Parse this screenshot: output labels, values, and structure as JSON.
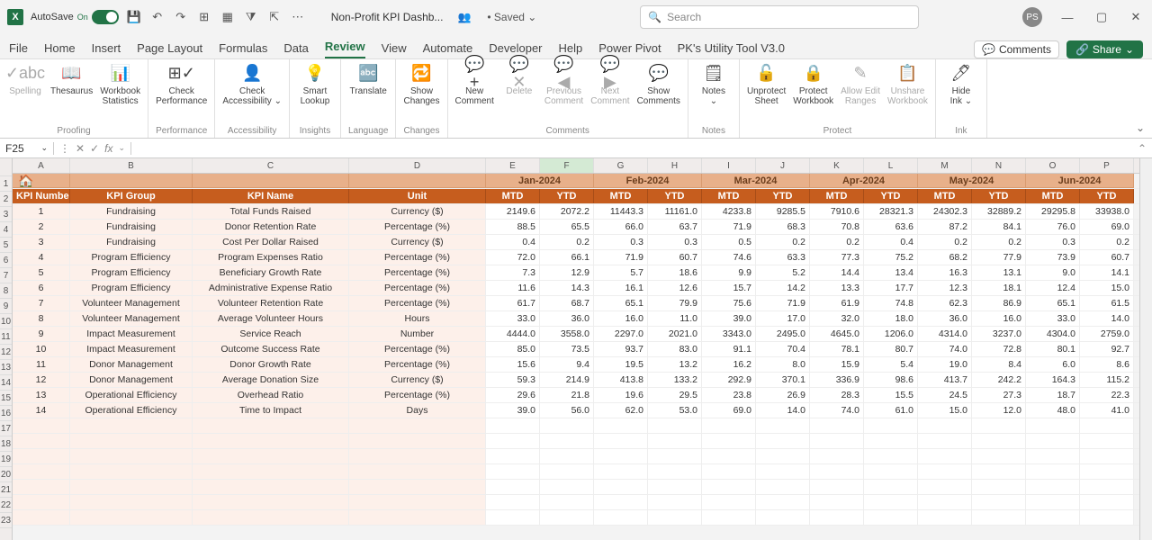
{
  "titlebar": {
    "autosave_label": "AutoSave",
    "autosave_state": "On",
    "filename": "Non-Profit KPI Dashb...",
    "saved_status": "• Saved ⌄",
    "search_placeholder": "Search",
    "avatar_initials": "PS"
  },
  "tabs": [
    "File",
    "Home",
    "Insert",
    "Page Layout",
    "Formulas",
    "Data",
    "Review",
    "View",
    "Automate",
    "Developer",
    "Help",
    "Power Pivot",
    "PK's Utility Tool V3.0"
  ],
  "active_tab": "Review",
  "tab_buttons": {
    "comments": "Comments",
    "share": "Share"
  },
  "ribbon": {
    "groups": [
      {
        "label": "Proofing",
        "items": [
          {
            "icon": "✓abc",
            "label": "Spelling",
            "disabled": true
          },
          {
            "icon": "📖",
            "label": "Thesaurus"
          },
          {
            "icon": "📊",
            "label": "Workbook\nStatistics"
          }
        ]
      },
      {
        "label": "Performance",
        "items": [
          {
            "icon": "⊞✓",
            "label": "Check\nPerformance"
          }
        ]
      },
      {
        "label": "Accessibility",
        "items": [
          {
            "icon": "👤",
            "label": "Check\nAccessibility ⌄"
          }
        ]
      },
      {
        "label": "Insights",
        "items": [
          {
            "icon": "💡",
            "label": "Smart\nLookup"
          }
        ]
      },
      {
        "label": "Language",
        "items": [
          {
            "icon": "🔤",
            "label": "Translate"
          }
        ]
      },
      {
        "label": "Changes",
        "items": [
          {
            "icon": "🔁",
            "label": "Show\nChanges"
          }
        ]
      },
      {
        "label": "Comments",
        "items": [
          {
            "icon": "💬+",
            "label": "New\nComment"
          },
          {
            "icon": "💬✕",
            "label": "Delete",
            "disabled": true
          },
          {
            "icon": "💬◀",
            "label": "Previous\nComment",
            "disabled": true
          },
          {
            "icon": "💬▶",
            "label": "Next\nComment",
            "disabled": true
          },
          {
            "icon": "💬",
            "label": "Show\nComments"
          }
        ]
      },
      {
        "label": "Notes",
        "items": [
          {
            "icon": "🗒",
            "label": "Notes\n⌄"
          }
        ]
      },
      {
        "label": "Protect",
        "items": [
          {
            "icon": "🔓",
            "label": "Unprotect\nSheet"
          },
          {
            "icon": "🔒",
            "label": "Protect\nWorkbook"
          },
          {
            "icon": "✎",
            "label": "Allow Edit\nRanges",
            "disabled": true
          },
          {
            "icon": "📋",
            "label": "Unshare\nWorkbook",
            "disabled": true
          }
        ]
      },
      {
        "label": "Ink",
        "items": [
          {
            "icon": "🖊",
            "label": "Hide\nInk ⌄"
          }
        ]
      }
    ]
  },
  "namebox": "F25",
  "grid": {
    "col_letters": [
      "A",
      "B",
      "C",
      "D",
      "E",
      "F",
      "G",
      "H",
      "I",
      "J",
      "K",
      "L",
      "M",
      "N",
      "O",
      "P"
    ],
    "selected_col": "F",
    "months": [
      "Jan-2024",
      "Feb-2024",
      "Mar-2024",
      "Apr-2024",
      "May-2024",
      "Jun-2024"
    ],
    "kpi_headers": [
      "KPI Number",
      "KPI Group",
      "KPI Name",
      "Unit"
    ],
    "sub_headers": [
      "MTD",
      "YTD"
    ],
    "rows": [
      {
        "n": "1",
        "g": "Fundraising",
        "k": "Total Funds Raised",
        "u": "Currency ($)",
        "v": [
          "2149.6",
          "2072.2",
          "11443.3",
          "11161.0",
          "4233.8",
          "9285.5",
          "7910.6",
          "28321.3",
          "24302.3",
          "32889.2",
          "29295.8",
          "33938.0"
        ]
      },
      {
        "n": "2",
        "g": "Fundraising",
        "k": "Donor Retention Rate",
        "u": "Percentage (%)",
        "v": [
          "88.5",
          "65.5",
          "66.0",
          "63.7",
          "71.9",
          "68.3",
          "70.8",
          "63.6",
          "87.2",
          "84.1",
          "76.0",
          "69.0"
        ]
      },
      {
        "n": "3",
        "g": "Fundraising",
        "k": "Cost Per Dollar Raised",
        "u": "Currency ($)",
        "v": [
          "0.4",
          "0.2",
          "0.3",
          "0.3",
          "0.5",
          "0.2",
          "0.2",
          "0.4",
          "0.2",
          "0.2",
          "0.3",
          "0.2"
        ]
      },
      {
        "n": "4",
        "g": "Program Efficiency",
        "k": "Program Expenses Ratio",
        "u": "Percentage (%)",
        "v": [
          "72.0",
          "66.1",
          "71.9",
          "60.7",
          "74.6",
          "63.3",
          "77.3",
          "75.2",
          "68.2",
          "77.9",
          "73.9",
          "60.7"
        ]
      },
      {
        "n": "5",
        "g": "Program Efficiency",
        "k": "Beneficiary Growth Rate",
        "u": "Percentage (%)",
        "v": [
          "7.3",
          "12.9",
          "5.7",
          "18.6",
          "9.9",
          "5.2",
          "14.4",
          "13.4",
          "16.3",
          "13.1",
          "9.0",
          "14.1"
        ]
      },
      {
        "n": "6",
        "g": "Program Efficiency",
        "k": "Administrative Expense Ratio",
        "u": "Percentage (%)",
        "v": [
          "11.6",
          "14.3",
          "16.1",
          "12.6",
          "15.7",
          "14.2",
          "13.3",
          "17.7",
          "12.3",
          "18.1",
          "12.4",
          "15.0"
        ]
      },
      {
        "n": "7",
        "g": "Volunteer Management",
        "k": "Volunteer Retention Rate",
        "u": "Percentage (%)",
        "v": [
          "61.7",
          "68.7",
          "65.1",
          "79.9",
          "75.6",
          "71.9",
          "61.9",
          "74.8",
          "62.3",
          "86.9",
          "65.1",
          "61.5"
        ]
      },
      {
        "n": "8",
        "g": "Volunteer Management",
        "k": "Average Volunteer Hours",
        "u": "Hours",
        "v": [
          "33.0",
          "36.0",
          "16.0",
          "11.0",
          "39.0",
          "17.0",
          "32.0",
          "18.0",
          "36.0",
          "16.0",
          "33.0",
          "14.0"
        ]
      },
      {
        "n": "9",
        "g": "Impact Measurement",
        "k": "Service Reach",
        "u": "Number",
        "v": [
          "4444.0",
          "3558.0",
          "2297.0",
          "2021.0",
          "3343.0",
          "2495.0",
          "4645.0",
          "1206.0",
          "4314.0",
          "3237.0",
          "4304.0",
          "2759.0"
        ]
      },
      {
        "n": "10",
        "g": "Impact Measurement",
        "k": "Outcome Success Rate",
        "u": "Percentage (%)",
        "v": [
          "85.0",
          "73.5",
          "93.7",
          "83.0",
          "91.1",
          "70.4",
          "78.1",
          "80.7",
          "74.0",
          "72.8",
          "80.1",
          "92.7"
        ]
      },
      {
        "n": "11",
        "g": "Donor Management",
        "k": "Donor Growth Rate",
        "u": "Percentage (%)",
        "v": [
          "15.6",
          "9.4",
          "19.5",
          "13.2",
          "16.2",
          "8.0",
          "15.9",
          "5.4",
          "19.0",
          "8.4",
          "6.0",
          "8.6"
        ]
      },
      {
        "n": "12",
        "g": "Donor Management",
        "k": "Average Donation Size",
        "u": "Currency ($)",
        "v": [
          "59.3",
          "214.9",
          "413.8",
          "133.2",
          "292.9",
          "370.1",
          "336.9",
          "98.6",
          "413.7",
          "242.2",
          "164.3",
          "115.2"
        ]
      },
      {
        "n": "13",
        "g": "Operational Efficiency",
        "k": "Overhead Ratio",
        "u": "Percentage (%)",
        "v": [
          "29.6",
          "21.8",
          "19.6",
          "29.5",
          "23.8",
          "26.9",
          "28.3",
          "15.5",
          "24.5",
          "27.3",
          "18.7",
          "22.3"
        ]
      },
      {
        "n": "14",
        "g": "Operational Efficiency",
        "k": "Time to Impact",
        "u": "Days",
        "v": [
          "39.0",
          "56.0",
          "62.0",
          "53.0",
          "69.0",
          "14.0",
          "74.0",
          "61.0",
          "15.0",
          "12.0",
          "48.0",
          "41.0"
        ]
      }
    ],
    "row_numbers": [
      "1",
      "2",
      "3",
      "4",
      "5",
      "6",
      "7",
      "8",
      "9",
      "10",
      "11",
      "12",
      "13",
      "14",
      "15",
      "16",
      "17",
      "18",
      "19",
      "20",
      "21",
      "22",
      "23"
    ]
  }
}
